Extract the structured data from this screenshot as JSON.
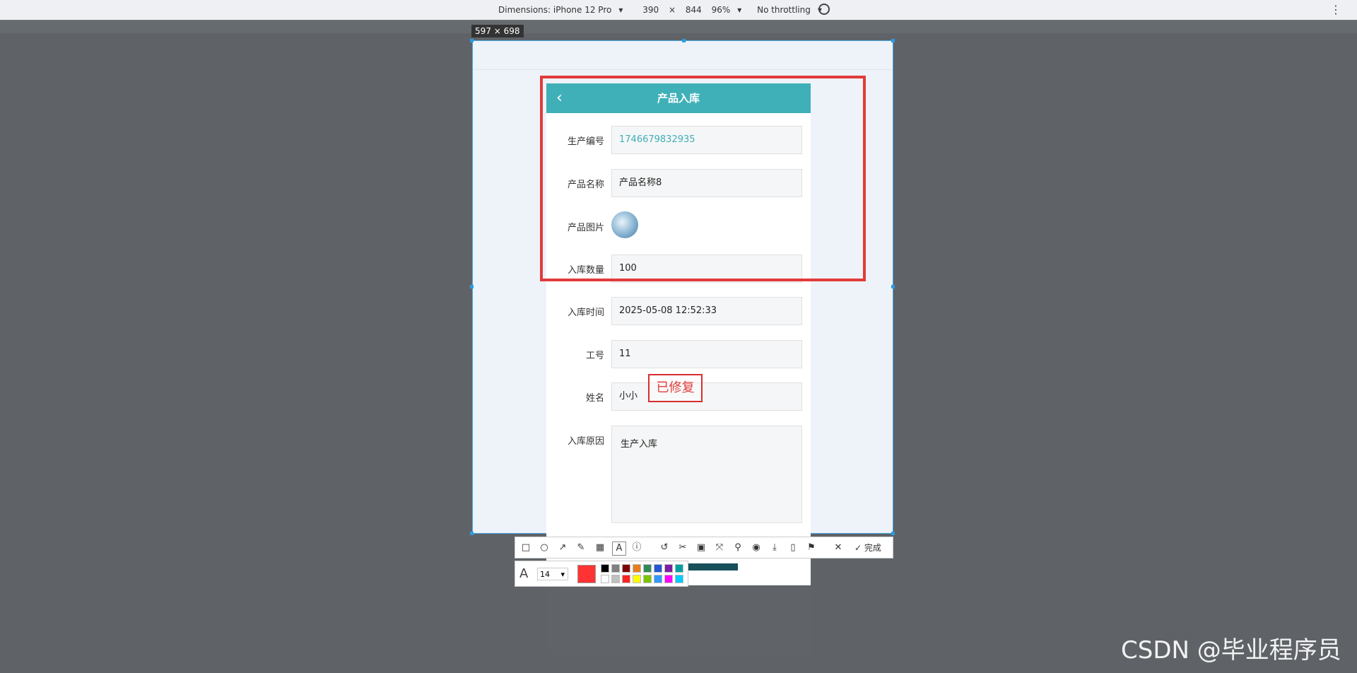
{
  "devtools": {
    "dimensions_label": "Dimensions: iPhone 12 Pro",
    "width": "390",
    "times": "×",
    "height": "844",
    "zoom": "96%",
    "throttling": "No throttling",
    "size_badge": "597 × 698"
  },
  "page": {
    "title": "产品入库",
    "back_icon": "chevron-left-icon",
    "fields": [
      {
        "label": "生产编号",
        "value": "1746679832935"
      },
      {
        "label": "产品名称",
        "value": "产品名称8"
      },
      {
        "label": "产品图片"
      },
      {
        "label": "入库数量",
        "value": "100"
      },
      {
        "label": "入库时间",
        "value": "2025-05-08 12:52:33"
      },
      {
        "label": "工号",
        "value": "11"
      },
      {
        "label": "姓名",
        "value": "小小"
      },
      {
        "label": "入库原因",
        "value": "生产入库"
      }
    ]
  },
  "annotation": {
    "text": "已修复",
    "color": "#e23b3b"
  },
  "screenshot_tool": {
    "done_label": "完成",
    "font_size": "14",
    "current_color": "#ff3333",
    "palette": [
      "#000000",
      "#808080",
      "#800000",
      "#e67e22",
      "#2e8b57",
      "#2456d6",
      "#7b1fa2",
      "#00a0a0",
      "#ffffff",
      "#c0c0c0",
      "#ff2222",
      "#ffff00",
      "#7cc400",
      "#3399ff",
      "#ff00ff",
      "#00ccff"
    ]
  },
  "watermark": "CSDN @毕业程序员"
}
